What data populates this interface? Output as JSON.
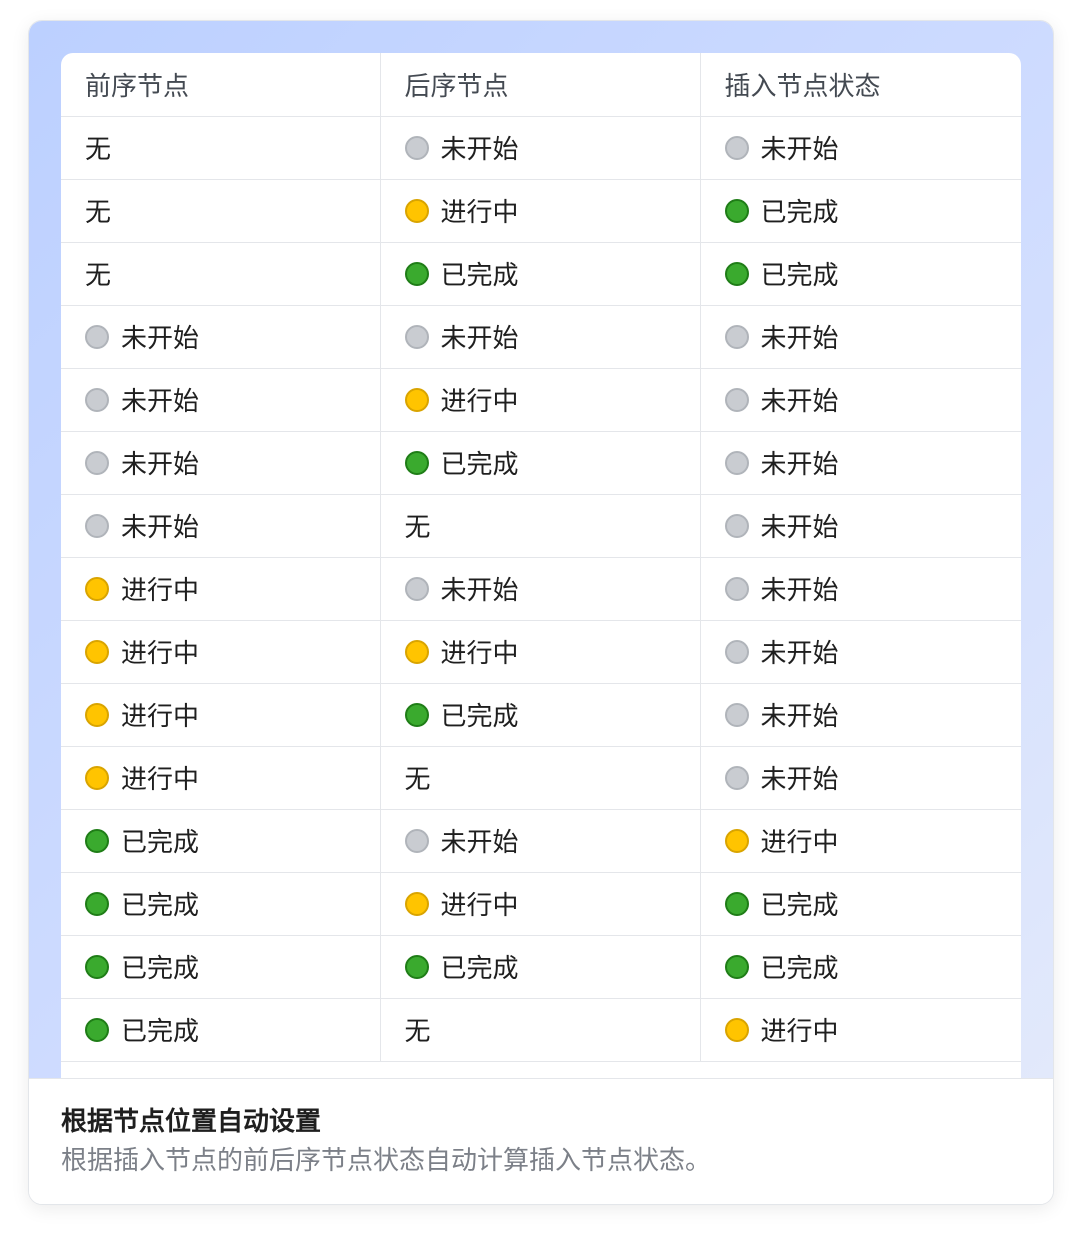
{
  "table": {
    "headers": [
      "前序节点",
      "后序节点",
      "插入节点状态"
    ],
    "status_labels": {
      "none": "无",
      "notstarted": "未开始",
      "inprogress": "进行中",
      "completed": "已完成"
    },
    "status_colors": {
      "notstarted": "#c9ccd1",
      "inprogress": "#ffc400",
      "completed": "#3aaa2e"
    },
    "rows": [
      [
        "none",
        "notstarted",
        "notstarted"
      ],
      [
        "none",
        "inprogress",
        "completed"
      ],
      [
        "none",
        "completed",
        "completed"
      ],
      [
        "notstarted",
        "notstarted",
        "notstarted"
      ],
      [
        "notstarted",
        "inprogress",
        "notstarted"
      ],
      [
        "notstarted",
        "completed",
        "notstarted"
      ],
      [
        "notstarted",
        "none",
        "notstarted"
      ],
      [
        "inprogress",
        "notstarted",
        "notstarted"
      ],
      [
        "inprogress",
        "inprogress",
        "notstarted"
      ],
      [
        "inprogress",
        "completed",
        "notstarted"
      ],
      [
        "inprogress",
        "none",
        "notstarted"
      ],
      [
        "completed",
        "notstarted",
        "inprogress"
      ],
      [
        "completed",
        "inprogress",
        "completed"
      ],
      [
        "completed",
        "completed",
        "completed"
      ],
      [
        "completed",
        "none",
        "inprogress"
      ]
    ]
  },
  "footer": {
    "title": "根据节点位置自动设置",
    "description": "根据插入节点的前后序节点状态自动计算插入节点状态。"
  }
}
